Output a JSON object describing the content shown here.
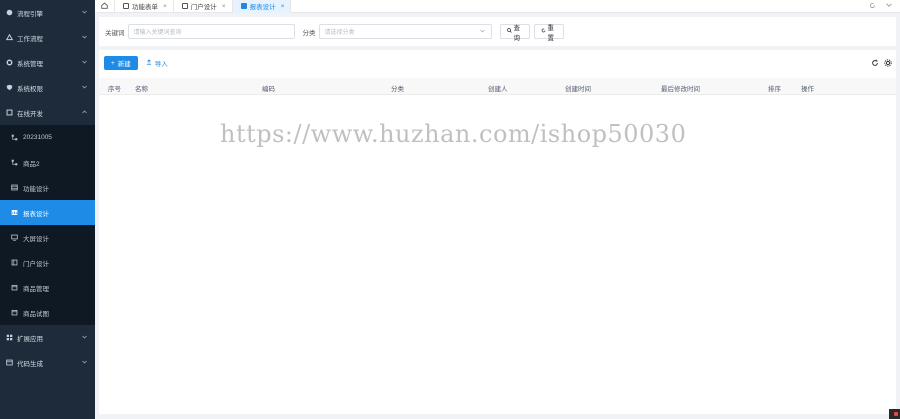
{
  "sidebar": {
    "menu_top": [
      {
        "label": "流程引擎",
        "icon": "flow-icon"
      },
      {
        "label": "工作流程",
        "icon": "tree-icon"
      },
      {
        "label": "系统管理",
        "icon": "gear-icon"
      },
      {
        "label": "系统权限",
        "icon": "shield-icon"
      },
      {
        "label": "在线开发",
        "icon": "book-icon"
      }
    ],
    "submenu": [
      {
        "label": "20231005",
        "icon": "hierarchy-icon"
      },
      {
        "label": "商品2",
        "icon": "hierarchy-icon"
      },
      {
        "label": "功能设计",
        "icon": "table-icon"
      },
      {
        "label": "报表设计",
        "icon": "chart-icon"
      },
      {
        "label": "大屏设计",
        "icon": "screen-icon"
      },
      {
        "label": "门户设计",
        "icon": "portal-icon"
      },
      {
        "label": "商品管理",
        "icon": "box-icon"
      },
      {
        "label": "商品试图",
        "icon": "box-icon"
      }
    ],
    "menu_bottom": [
      {
        "label": "扩展应用",
        "icon": "apps-icon"
      },
      {
        "label": "代码生成",
        "icon": "code-icon"
      }
    ]
  },
  "tabs": {
    "items": [
      {
        "label": "功能表单"
      },
      {
        "label": "门户设计"
      },
      {
        "label": "报表设计"
      }
    ]
  },
  "search": {
    "keyword_label": "关键词",
    "keyword_placeholder": "请输入关键词查询",
    "category_label": "分类",
    "category_placeholder": "请选择分类",
    "query_button": "查 询",
    "reset_button": "重 置"
  },
  "toolbar": {
    "new_button": "新建",
    "import_button": "导入"
  },
  "table": {
    "columns": [
      "序号",
      "名称",
      "编码",
      "分类",
      "创建人",
      "创建时间",
      "最后修改时间",
      "排序",
      "操作"
    ]
  },
  "watermark": "https://www.huzhan.com/ishop50030",
  "colors": {
    "sidebar_bg": "#1d2b3a",
    "submenu_bg": "#0f1923",
    "accent": "#1e8be6"
  }
}
